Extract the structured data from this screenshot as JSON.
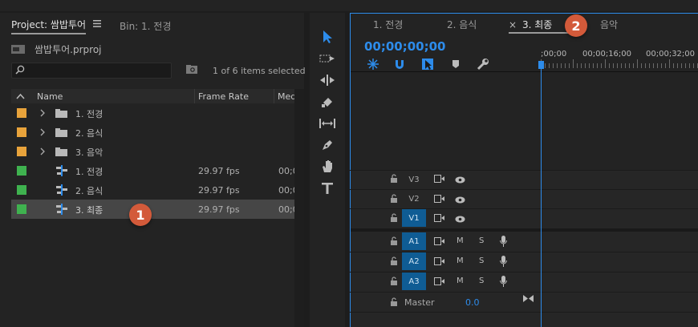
{
  "project_panel": {
    "project_tab": "Project: 쌈밥투어",
    "bin_tab": "Bin: 1. 전경",
    "project_file": "쌈밥투어.prproj",
    "selection_status": "1 of 6 items selected",
    "columns": [
      "Name",
      "Frame Rate",
      "Med"
    ],
    "items": [
      {
        "label": "1. 전경",
        "type": "bin",
        "color": "#e8a33b",
        "frame_rate": "",
        "media": ""
      },
      {
        "label": "2. 음식",
        "type": "bin",
        "color": "#e8a33b",
        "frame_rate": "",
        "media": ""
      },
      {
        "label": "3. 음악",
        "type": "bin",
        "color": "#e8a33b",
        "frame_rate": "",
        "media": ""
      },
      {
        "label": "1. 전경",
        "type": "sequence",
        "color": "#3fb24f",
        "frame_rate": "29.97 fps",
        "media": "00;0"
      },
      {
        "label": "2. 음식",
        "type": "sequence",
        "color": "#3fb24f",
        "frame_rate": "29.97 fps",
        "media": "00;0"
      },
      {
        "label": "3. 최종",
        "type": "sequence",
        "color": "#3fb24f",
        "frame_rate": "29.97 fps",
        "media": "00;0",
        "selected": true
      }
    ]
  },
  "tools": [
    "selection-tool",
    "track-select-tool",
    "ripple-edit-tool",
    "razor-tool",
    "slip-tool",
    "pen-tool",
    "hand-tool",
    "type-tool"
  ],
  "timeline": {
    "tabs": [
      {
        "label": "1. 전경",
        "active": false
      },
      {
        "label": "2. 음식",
        "active": false
      },
      {
        "label": "3. 최종",
        "active": true
      },
      {
        "label": "음악",
        "active": false
      }
    ],
    "close_glyph": "×",
    "timecode": "00;00;00;00",
    "ruler_labels": [
      ";00;00",
      "00;00;16;00",
      "00;00;32;00"
    ],
    "video_tracks": [
      {
        "name": "V3",
        "target": false
      },
      {
        "name": "V2",
        "target": false
      },
      {
        "name": "V1",
        "target": true
      }
    ],
    "audio_tracks": [
      {
        "name": "A1",
        "m": "M",
        "s": "S"
      },
      {
        "name": "A2",
        "m": "M",
        "s": "S"
      },
      {
        "name": "A3",
        "m": "M",
        "s": "S"
      }
    ],
    "master_label": "Master",
    "master_value": "0.0"
  },
  "callouts": [
    "1",
    "2"
  ],
  "colors": {
    "accent": "#2d8ceb",
    "bin": "#e8a33b",
    "sequence": "#3fb24f",
    "callout": "#d35a3a",
    "track_target": "#0f5c94"
  }
}
